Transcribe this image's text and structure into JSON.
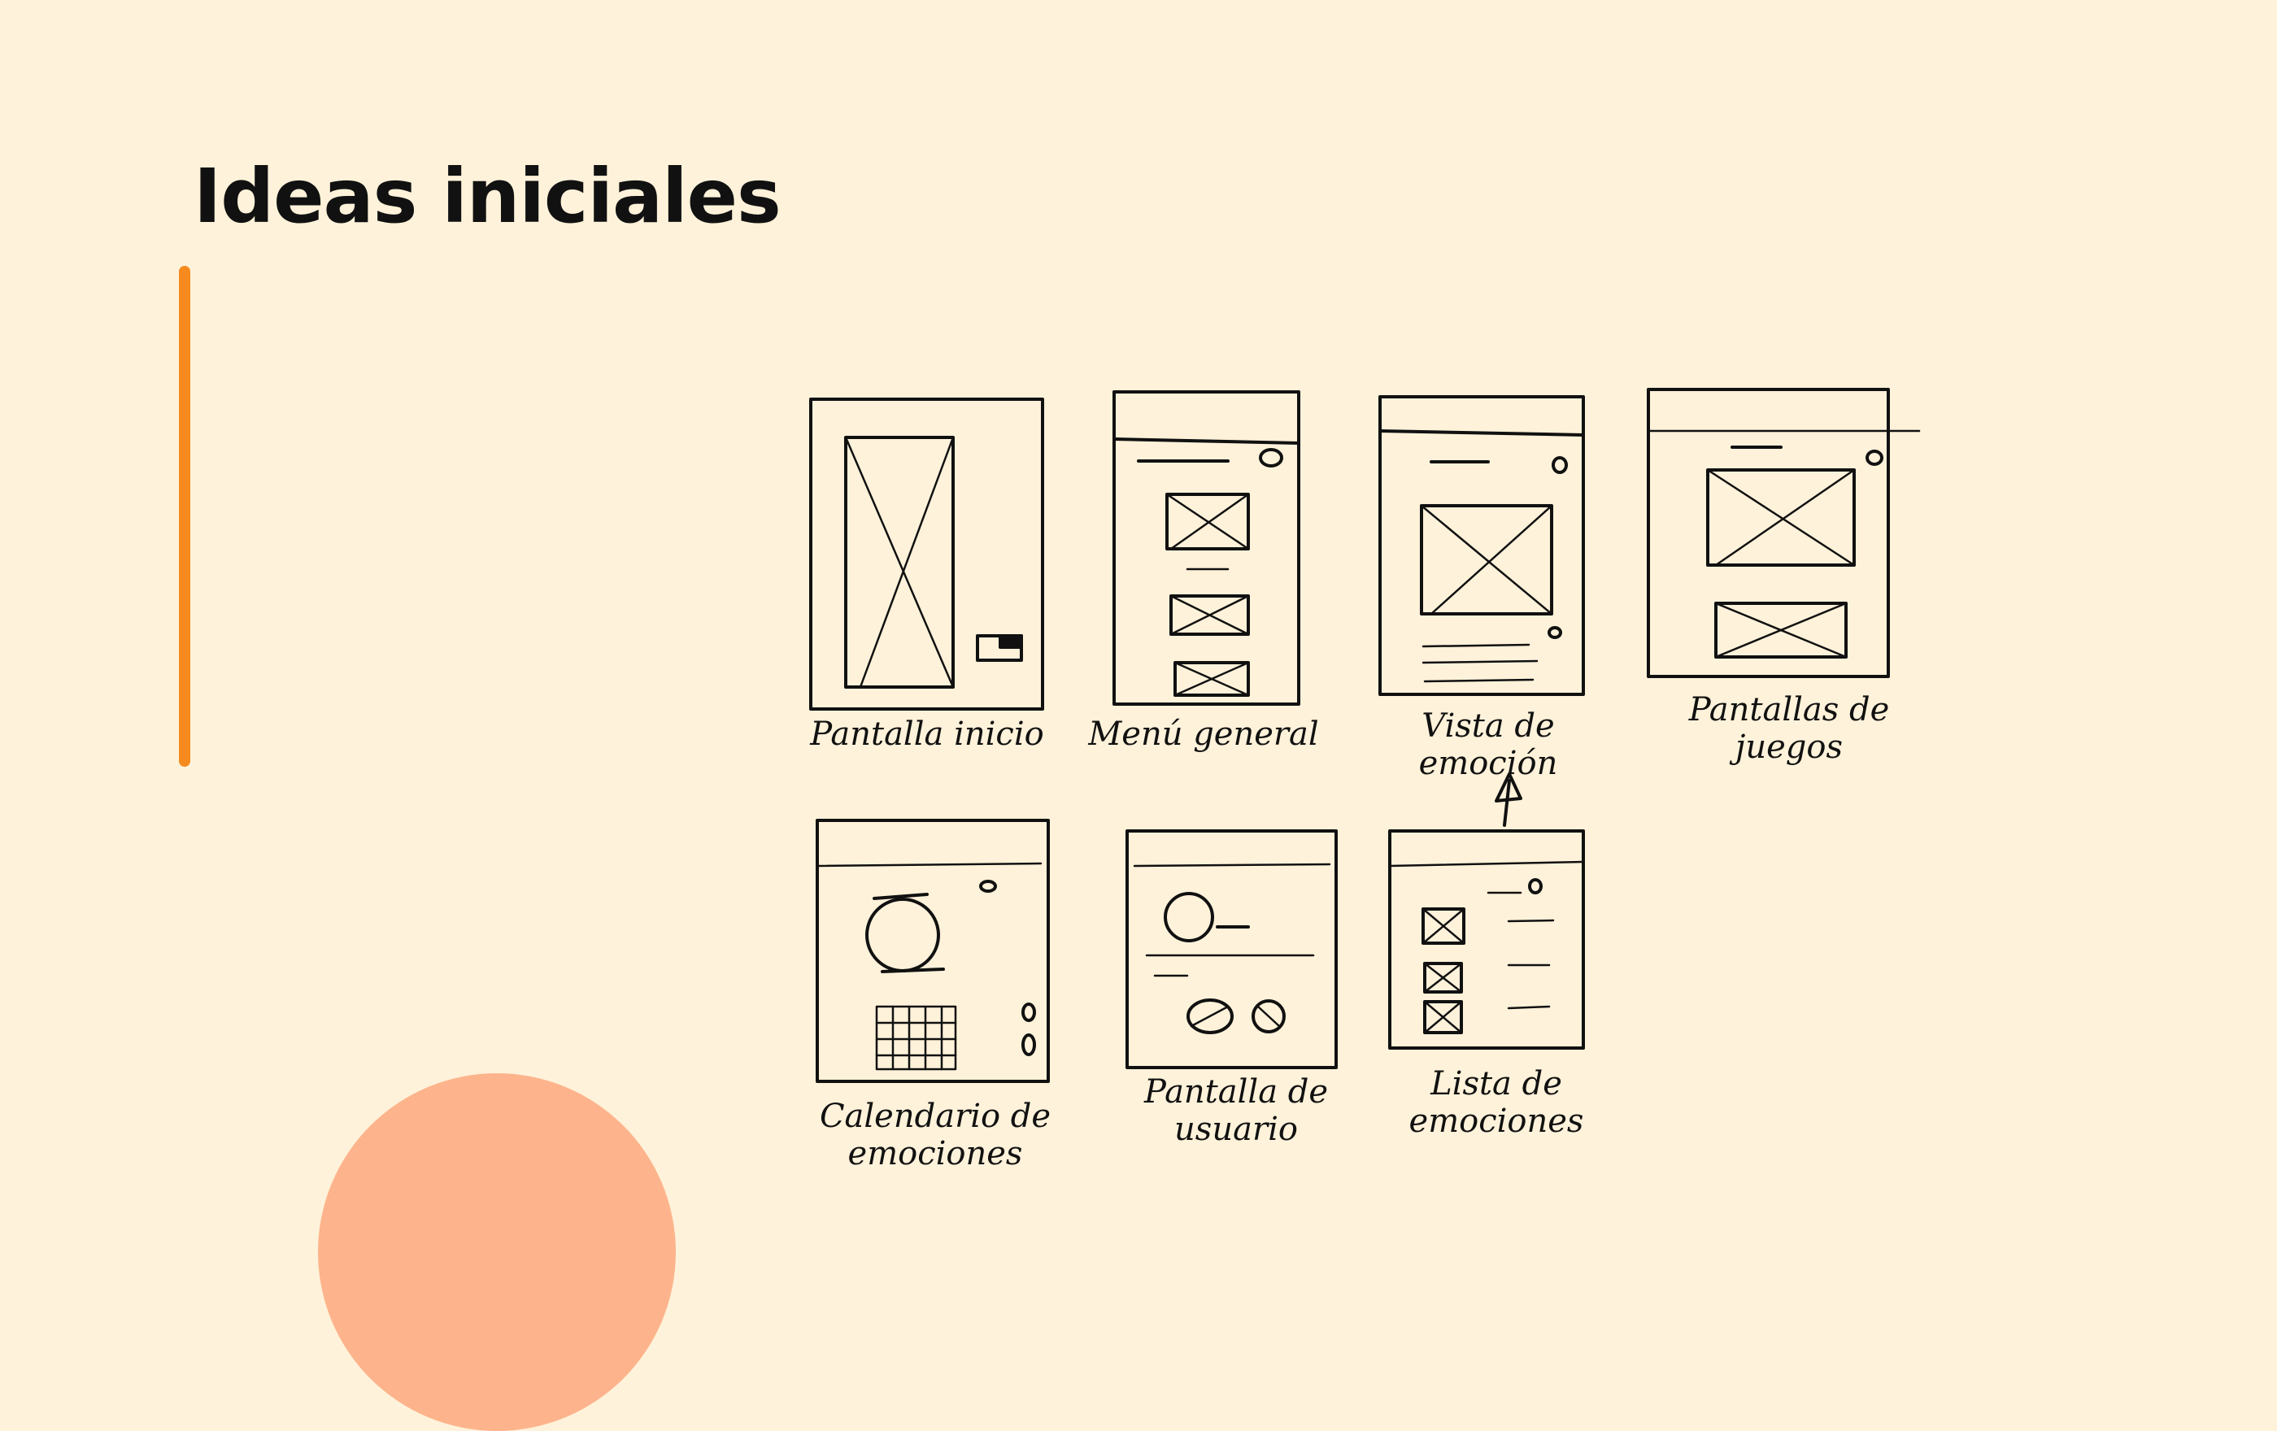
{
  "slide": {
    "title": "Ideas iniciales",
    "colors": {
      "background": "#FFF2DA",
      "accent_bar": "#F68A1E",
      "decor_circle": "#FDB48C",
      "ink": "#111111"
    }
  },
  "sketches": [
    {
      "label": "Pantalla inicio"
    },
    {
      "label": "Menú general"
    },
    {
      "label": "Vista de emoción"
    },
    {
      "label": "Pantallas de juegos"
    },
    {
      "label": "Calendario de emociones"
    },
    {
      "label": "Pantalla de usuario"
    },
    {
      "label": "Lista de emociones"
    }
  ]
}
